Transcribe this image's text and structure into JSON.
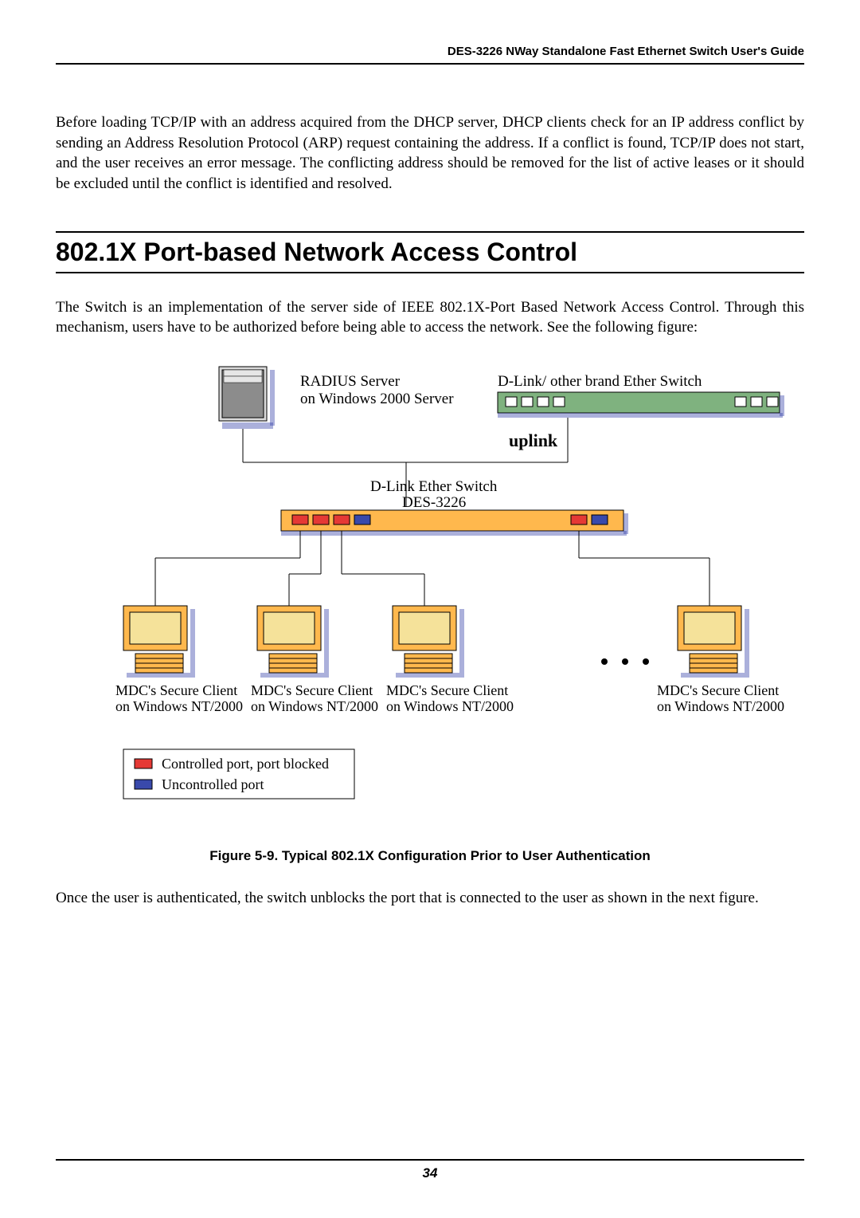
{
  "header": {
    "title": "DES-3226 NWay Standalone Fast Ethernet Switch User's Guide"
  },
  "paragraphs": {
    "p1": "Before loading TCP/IP with an address acquired from the DHCP server, DHCP clients check for an IP address conflict by sending an Address Resolution Protocol (ARP) request containing the address. If a conflict is found, TCP/IP does not start, and the user receives an error message. The conflicting address should be removed for the list of active leases or it should be excluded until the conflict is identified and resolved.",
    "p2": "The Switch is an implementation of the server side of IEEE 802.1X-Port Based Network Access Control. Through this mechanism, users have to be authorized before being able to access the network. See the following figure:",
    "p3": "Once the user is authenticated, the switch unblocks the port that is connected to the user as shown in the next figure."
  },
  "section_heading": "802.1X Port-based Network Access Control",
  "figure": {
    "caption": "Figure 5-9.  Typical 802.1X Configuration Prior to User Authentication",
    "labels": {
      "radius1": "RADIUS Server",
      "radius2": "on Windows 2000 Server",
      "other_switch": "D-Link/ other brand Ether Switch",
      "uplink": "uplink",
      "switch1": "D-Link Ether Switch",
      "switch2": "DES-3226",
      "client1a": "MDC's Secure Client",
      "client1b": "on Windows NT/2000",
      "client2a": "MDC's Secure Client",
      "client2b": "on Windows NT/2000",
      "client3a": "MDC's Secure Client",
      "client3b": "on Windows NT/2000",
      "client4a": "MDC's Secure Client",
      "client4b": "on Windows NT/2000",
      "legend1": "Controlled port, port blocked",
      "legend2": "Uncontrolled port"
    }
  },
  "page_number": "34"
}
